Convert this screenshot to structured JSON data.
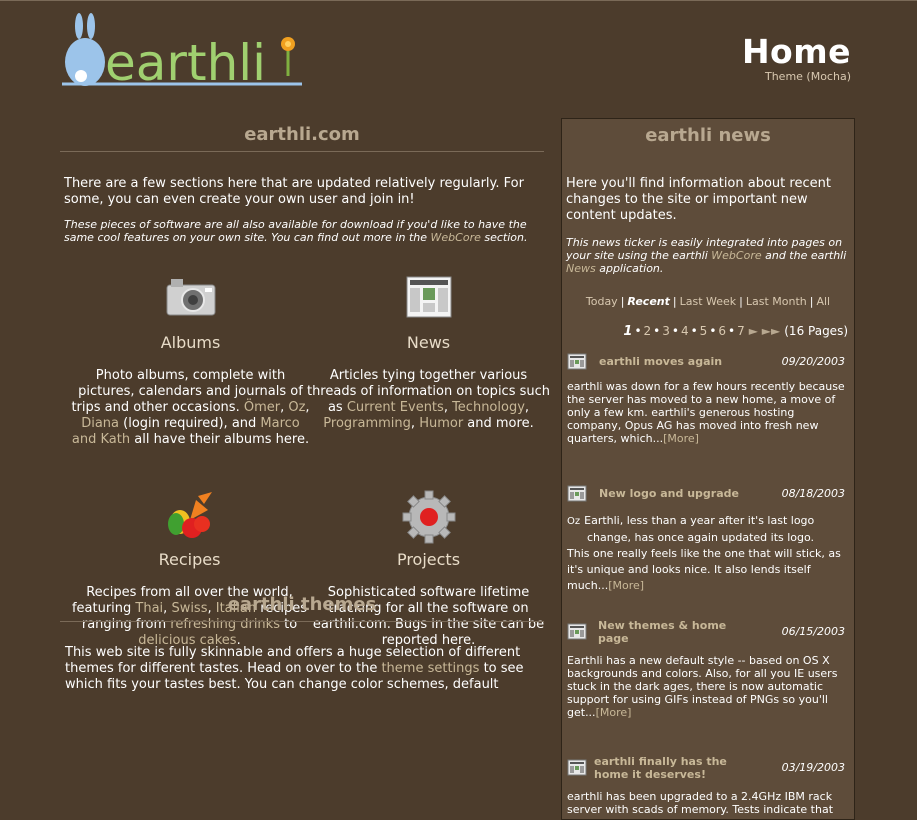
{
  "header": {
    "page_title": "Home",
    "theme_label": "Theme (Mocha)"
  },
  "left": {
    "section_title": "earthli.com",
    "intro": "There are a few sections here that are updated relatively regularly. For some, you can even create your own user and join in!",
    "note_a": "These pieces of software are all also available for download if you'd like to have the same cool features on your own site. You can find out more in the ",
    "note_link": "WebCore",
    "note_b": " section.",
    "albums": {
      "title": "Albums",
      "t1": "Photo albums, complete with pictures, calendars and journals of trips and other occasions. ",
      "l1": "Ömer",
      "s1": ", ",
      "l2": "Oz",
      "s2": ", ",
      "l3": "Diana",
      "t2": " (login required), and ",
      "l4": "Marco and Kath",
      "t3": " all have their albums here."
    },
    "news": {
      "title": "News",
      "t1": "Articles tying together various threads of information on topics such as ",
      "l1": "Current Events",
      "s1": ", ",
      "l2": "Technology",
      "s2": ", ",
      "l3": "Programming",
      "s3": ", ",
      "l4": "Humor",
      "t2": " and more."
    },
    "recipes": {
      "title": "Recipes",
      "t1": "Recipes from all over the world, featuring ",
      "l1": "Thai",
      "s1": ", ",
      "l2": "Swiss",
      "s2": ", ",
      "l3": "Italian",
      "t2": " recipes ranging from ",
      "l4": "refreshing drinks",
      "t3": " to ",
      "l5": "delicious cakes",
      "t4": "."
    },
    "projects": {
      "title": "Projects",
      "text": "Sophisticated software lifetime tracking for all the software on earthli.com. Bugs in the site can be reported here."
    },
    "themes_title": "earthli themes",
    "themes_t1": "This web site is fully skinnable and offers a huge selection of different themes for different tastes. Head on over to the ",
    "themes_link": "theme settings",
    "themes_t2": " to see which fits your tastes best. You can change color schemes, default"
  },
  "news_panel": {
    "title": "earthli news",
    "intro": "Here you'll find information about recent changes to the site or important new content updates.",
    "note_a": "This news ticker is easily integrated into pages on your site using the earthli ",
    "note_l1": "WebCore",
    "note_b": " and the earthli ",
    "note_l2": "News",
    "note_c": " application.",
    "filters": [
      "Today",
      "Recent",
      "Last Week",
      "Last Month",
      "All"
    ],
    "pager": {
      "current": "1",
      "pages": [
        "2",
        "3",
        "4",
        "5",
        "6",
        "7"
      ],
      "arrows": "►  ►►",
      "total": "(16 Pages)"
    },
    "items": [
      {
        "title": "earthli moves again",
        "date": "09/20/2003",
        "body": "earthli was down for a few hours recently because the server has moved to a new home, a move of only a few km. earthli's generous hosting company, Opus AG has moved into fresh new quarters, which...",
        "more": "[More]"
      },
      {
        "title": "New logo and upgrade",
        "date": "08/18/2003",
        "author": "Oz",
        "body_a": "Earthli, less than a year after it's last logo change, has once again updated its logo.",
        "body_b": "This one really feels like the one that will stick, as it's unique and looks nice. It also lends itself much...",
        "more": "[More]"
      },
      {
        "title": "New themes & home page",
        "date": "06/15/2003",
        "body": "Earthli has a new default style -- based on OS X backgrounds and colors. Also, for all you IE users stuck in the dark ages, there is now automatic support for using GIFs instead of PNGs so you'll get...",
        "more": "[More]"
      },
      {
        "title": "earthli finally has the home it deserves!",
        "date": "03/19/2003",
        "body": "earthli has been upgraded to a 2.4GHz IBM rack server with scads of memory. Tests indicate that"
      }
    ]
  },
  "colors": {
    "background": "#4c3c2c",
    "panel": "#5e4c3a",
    "heading": "#b8a890",
    "link": "#c8b898"
  }
}
